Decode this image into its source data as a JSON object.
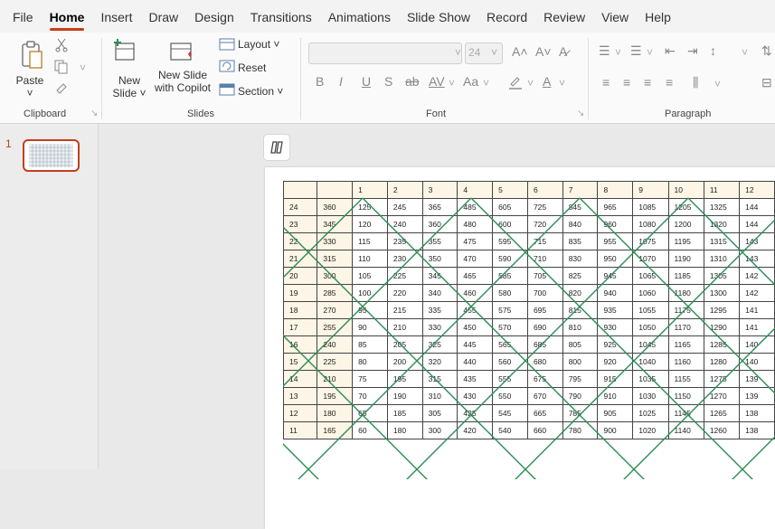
{
  "menu": [
    "File",
    "Home",
    "Insert",
    "Draw",
    "Design",
    "Transitions",
    "Animations",
    "Slide Show",
    "Record",
    "Review",
    "View",
    "Help"
  ],
  "active_tab": "Home",
  "ribbon": {
    "clipboard": {
      "paste": "Paste",
      "label": "Clipboard"
    },
    "slides": {
      "new_slide_1": "New",
      "new_slide_2": "Slide ˅",
      "copilot_1": "New Slide",
      "copilot_2": "with Copilot",
      "layout": "Layout ˅",
      "reset": "Reset",
      "section": "Section ˅",
      "label": "Slides"
    },
    "font": {
      "size": "24",
      "label": "Font",
      "bold": "B",
      "italic": "I",
      "underline": "U",
      "shadow": "S",
      "strike": "ab",
      "spacing": "AV",
      "case": "Aa",
      "grow": "A˄",
      "shrink": "A˅"
    },
    "paragraph": {
      "label": "Paragraph"
    }
  },
  "slide_panel": {
    "number": "1"
  },
  "table": {
    "header": [
      "",
      "",
      "1",
      "2",
      "3",
      "4",
      "5",
      "6",
      "7",
      "8",
      "9",
      "10",
      "11",
      "12"
    ],
    "rows": [
      [
        "24",
        "360",
        "125",
        "245",
        "365",
        "485",
        "605",
        "725",
        "845",
        "965",
        "1085",
        "1205",
        "1325",
        "144"
      ],
      [
        "23",
        "345",
        "120",
        "240",
        "360",
        "480",
        "600",
        "720",
        "840",
        "960",
        "1080",
        "1200",
        "1320",
        "144"
      ],
      [
        "22",
        "330",
        "115",
        "235",
        "355",
        "475",
        "595",
        "715",
        "835",
        "955",
        "1075",
        "1195",
        "1315",
        "143"
      ],
      [
        "21",
        "315",
        "110",
        "230",
        "350",
        "470",
        "590",
        "710",
        "830",
        "950",
        "1070",
        "1190",
        "1310",
        "143"
      ],
      [
        "20",
        "300",
        "105",
        "225",
        "345",
        "465",
        "585",
        "705",
        "825",
        "945",
        "1065",
        "1185",
        "1305",
        "142"
      ],
      [
        "19",
        "285",
        "100",
        "220",
        "340",
        "460",
        "580",
        "700",
        "820",
        "940",
        "1060",
        "1180",
        "1300",
        "142"
      ],
      [
        "18",
        "270",
        "95",
        "215",
        "335",
        "455",
        "575",
        "695",
        "815",
        "935",
        "1055",
        "1175",
        "1295",
        "141"
      ],
      [
        "17",
        "255",
        "90",
        "210",
        "330",
        "450",
        "570",
        "690",
        "810",
        "930",
        "1050",
        "1170",
        "1290",
        "141"
      ],
      [
        "16",
        "240",
        "85",
        "205",
        "325",
        "445",
        "565",
        "685",
        "805",
        "925",
        "1045",
        "1165",
        "1285",
        "140"
      ],
      [
        "15",
        "225",
        "80",
        "200",
        "320",
        "440",
        "560",
        "680",
        "800",
        "920",
        "1040",
        "1160",
        "1280",
        "140"
      ],
      [
        "14",
        "210",
        "75",
        "195",
        "315",
        "435",
        "555",
        "675",
        "795",
        "915",
        "1035",
        "1155",
        "1275",
        "139"
      ],
      [
        "13",
        "195",
        "70",
        "190",
        "310",
        "430",
        "550",
        "670",
        "790",
        "910",
        "1030",
        "1150",
        "1270",
        "139"
      ],
      [
        "12",
        "180",
        "65",
        "185",
        "305",
        "425",
        "545",
        "665",
        "785",
        "905",
        "1025",
        "1145",
        "1265",
        "138"
      ],
      [
        "11",
        "165",
        "60",
        "180",
        "300",
        "420",
        "540",
        "660",
        "780",
        "900",
        "1020",
        "1140",
        "1260",
        "138"
      ]
    ],
    "line_color": "#2e8b57"
  }
}
